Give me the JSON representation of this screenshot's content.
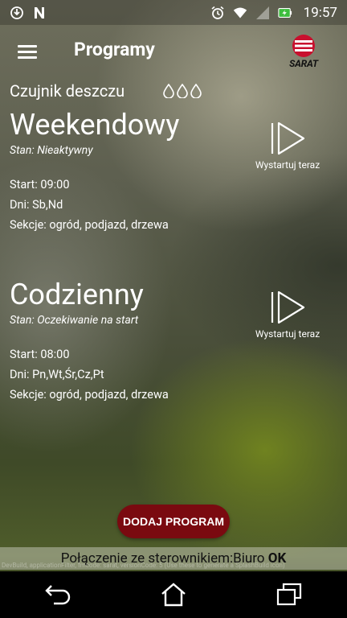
{
  "status_bar": {
    "time": "19:57",
    "icons": [
      "sync-icon",
      "n-notification-icon",
      "alarm-icon",
      "wifi-icon",
      "signal-icon",
      "battery-charging-icon"
    ]
  },
  "app_bar": {
    "title": "Programy",
    "logo_text": "SARAT"
  },
  "rain_sensor": {
    "label": "Czujnik deszczu"
  },
  "programs": [
    {
      "name": "Weekendowy",
      "state": "Stan: Nieaktywny",
      "start": "Start: 09:00",
      "days": "Dni: Sb,Nd",
      "sections": "Sekcje: ogród, podjazd, drzewa",
      "start_now_label": "Wystartuj teraz"
    },
    {
      "name": "Codzienny",
      "state": "Stan: Oczekiwanie na start",
      "start": "Start: 08:00",
      "days": "Dni: Pn,Wt,Śr,Cz,Pt",
      "sections": "Sekcje: ogród, podjazd, drzewa",
      "start_now_label": "Wystartuj teraz"
    }
  ],
  "add_program_label": "DODAJ PROGRAM",
  "connection": {
    "text": "Połączenie ze sterownikiem:Biuro",
    "status": "OK"
  },
  "debug_text": "DevBuild, applicationFilter, fmcode: sarat, versionCode: 5 (Use these to generate a SplashBuild icon)",
  "colors": {
    "add_button": "#7a0a10",
    "logo_red": "#c8102e"
  }
}
